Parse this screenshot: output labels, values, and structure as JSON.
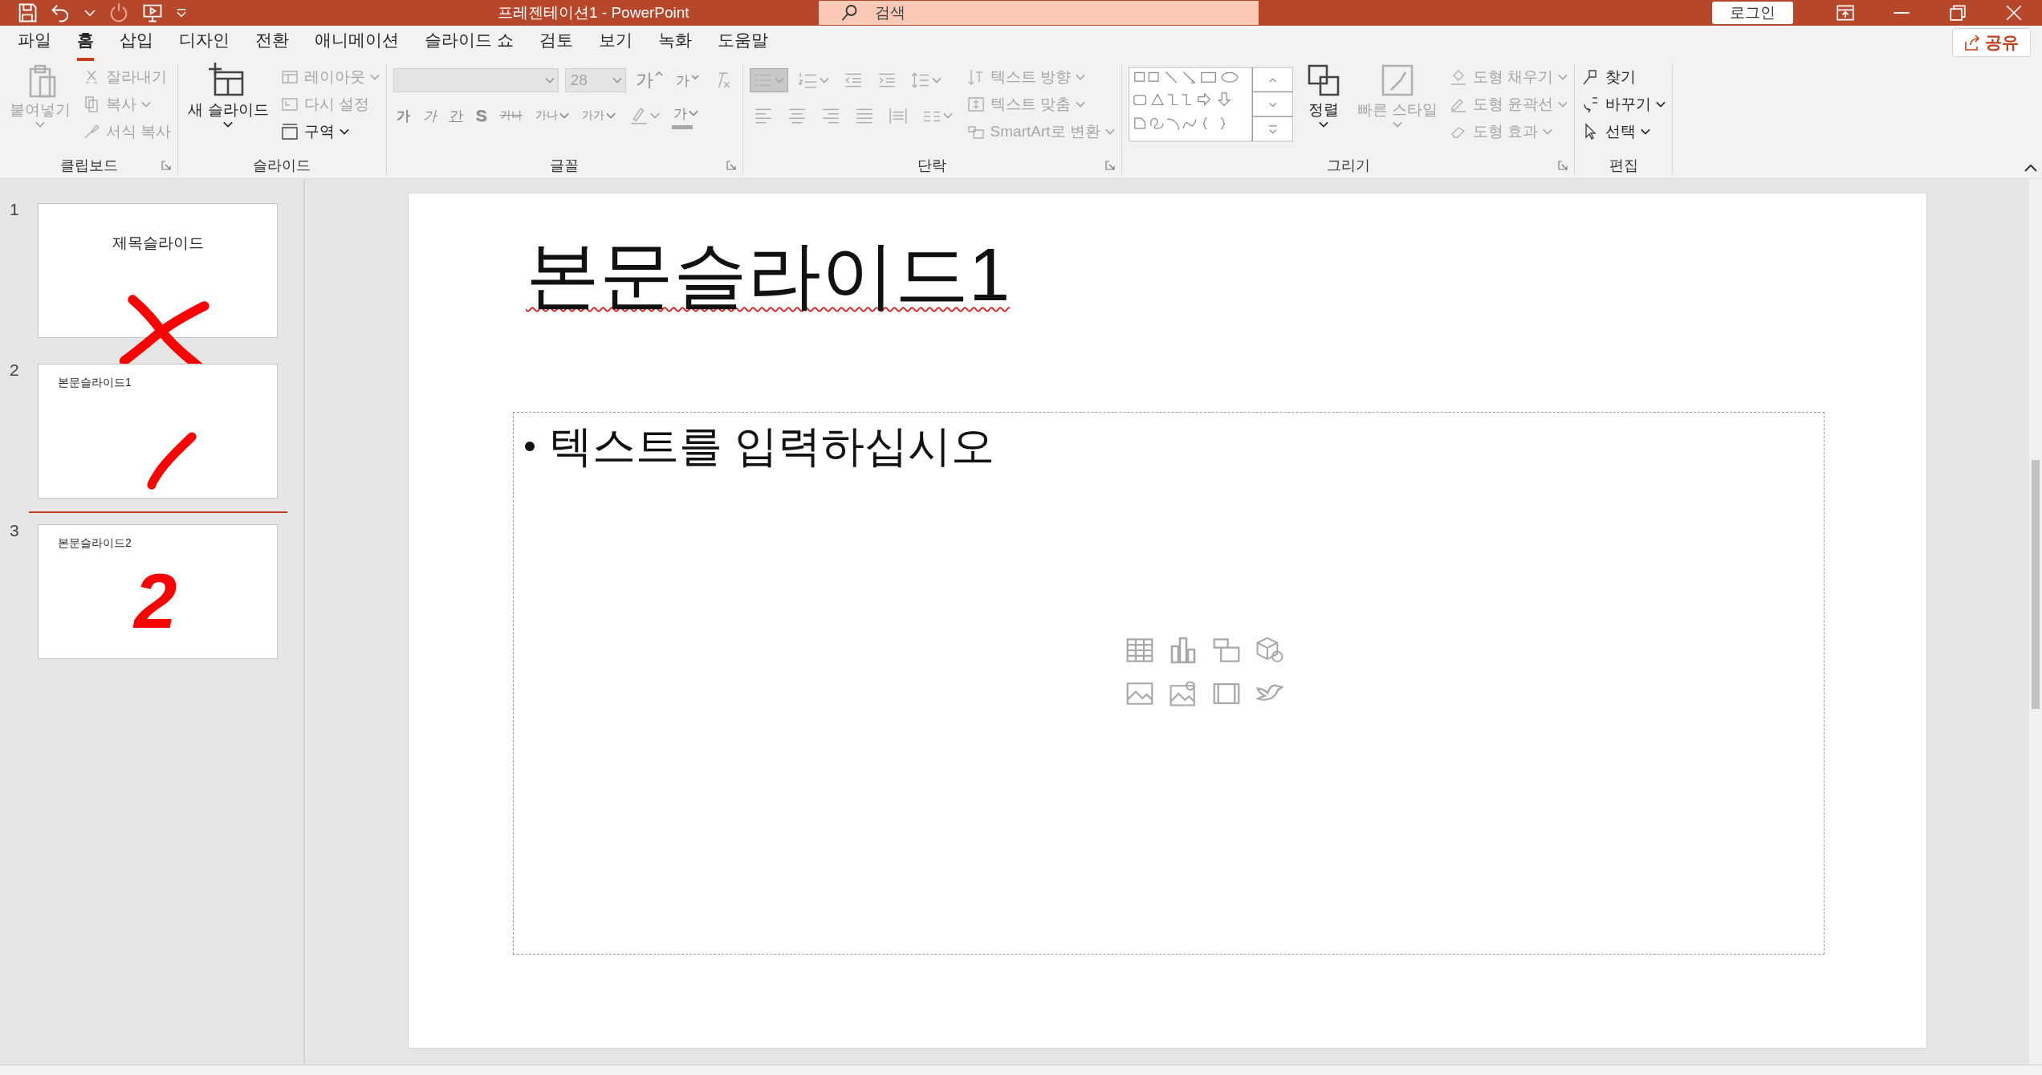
{
  "title_bar": {
    "title": "프레젠테이션1  -  PowerPoint",
    "search": {
      "placeholder": "검색"
    },
    "login_button": "로그인"
  },
  "tabs": [
    {
      "label": "파일",
      "selected": false
    },
    {
      "label": "홈",
      "selected": true
    },
    {
      "label": "삽입",
      "selected": false
    },
    {
      "label": "디자인",
      "selected": false
    },
    {
      "label": "전환",
      "selected": false
    },
    {
      "label": "애니메이션",
      "selected": false
    },
    {
      "label": "슬라이드 쇼",
      "selected": false
    },
    {
      "label": "검토",
      "selected": false
    },
    {
      "label": "보기",
      "selected": false
    },
    {
      "label": "녹화",
      "selected": false
    },
    {
      "label": "도움말",
      "selected": false
    }
  ],
  "share_button": "공유",
  "ribbon": {
    "groups": [
      {
        "label": "클립보드",
        "launcher": true,
        "items": [
          {
            "kind": "large",
            "label": "붙여넣기",
            "caret": true,
            "disabled": true
          },
          {
            "kind": "small",
            "label": "잘라내기",
            "caret": false,
            "disabled": true
          },
          {
            "kind": "small",
            "label": "복사",
            "caret": true,
            "disabled": true
          },
          {
            "kind": "small",
            "label": "서식 복사",
            "caret": false,
            "disabled": true
          }
        ]
      },
      {
        "label": "슬라이드",
        "launcher": false,
        "items": [
          {
            "kind": "large",
            "label": "새 슬라이드",
            "caret": true,
            "disabled": false
          },
          {
            "kind": "small",
            "label": "레이아웃",
            "caret": true,
            "disabled": true
          },
          {
            "kind": "small",
            "label": "다시 설정",
            "caret": false,
            "disabled": true
          },
          {
            "kind": "small",
            "label": "구역",
            "caret": true,
            "disabled": false
          }
        ]
      },
      {
        "label": "글꼴",
        "launcher": true,
        "toolbars": [
          {
            "buttons": [
              {
                "kind": "field",
                "disabled": true
              },
              {
                "kind": "field",
                "value": "28",
                "disabled": true
              },
              {
                "kind": "glyph",
                "label": "가",
                "caret": false,
                "disabled": true
              },
              {
                "kind": "glyph",
                "label": "가",
                "caret": false,
                "disabled": true
              },
              {
                "kind": "icon",
                "caret": false,
                "disabled": true,
                "selected": false
              }
            ]
          },
          {
            "buttons": [
              {
                "kind": "glyph",
                "label": "가",
                "caret": false,
                "disabled": true
              },
              {
                "kind": "glyph",
                "label": "가",
                "caret": false,
                "disabled": true
              },
              {
                "kind": "glyph",
                "label": "간",
                "caret": false,
                "disabled": true
              },
              {
                "kind": "glyph",
                "label": "S",
                "caret": false,
                "disabled": true
              },
              {
                "kind": "glyph",
                "label": "가나",
                "caret": false,
                "disabled": true
              },
              {
                "kind": "glyph",
                "label": "가나",
                "caret": true,
                "disabled": true
              },
              {
                "kind": "glyph",
                "label": "가가",
                "caret": true,
                "disabled": true
              },
              {
                "kind": "icon",
                "caret": true,
                "disabled": true,
                "selected": false
              },
              {
                "kind": "glyph",
                "label": "가",
                "caret": true,
                "disabled": true
              }
            ]
          }
        ]
      },
      {
        "label": "단락",
        "launcher": true,
        "toolbars": [
          {
            "buttons": [
              {
                "kind": "icon",
                "caret": true,
                "disabled": true,
                "selected": true
              },
              {
                "kind": "icon",
                "caret": true,
                "disabled": true,
                "selected": false
              },
              {
                "kind": "icon",
                "caret": false,
                "disabled": true,
                "selected": false
              },
              {
                "kind": "icon",
                "caret": false,
                "disabled": true,
                "selected": false
              },
              {
                "kind": "icon",
                "caret": true,
                "disabled": true,
                "selected": false
              }
            ]
          },
          {
            "buttons": [
              {
                "kind": "icon",
                "caret": false,
                "disabled": true,
                "selected": false
              },
              {
                "kind": "icon",
                "caret": false,
                "disabled": true,
                "selected": false
              },
              {
                "kind": "icon",
                "caret": false,
                "disabled": true,
                "selected": false
              },
              {
                "kind": "icon",
                "caret": false,
                "disabled": true,
                "selected": false
              },
              {
                "kind": "icon",
                "caret": false,
                "disabled": true,
                "selected": false
              },
              {
                "kind": "icon",
                "caret": true,
                "disabled": true,
                "selected": false
              }
            ]
          }
        ],
        "items": [
          {
            "kind": "small",
            "label": "텍스트 방향",
            "caret": true,
            "disabled": true
          },
          {
            "kind": "small",
            "label": "텍스트 맞춤",
            "caret": true,
            "disabled": true
          },
          {
            "kind": "small",
            "label": "SmartArt로 변환",
            "caret": true,
            "disabled": true
          }
        ]
      },
      {
        "label": "그리기",
        "launcher": true,
        "items": [
          {
            "kind": "gallery",
            "disabled": true
          },
          {
            "kind": "large",
            "label": "정렬",
            "caret": true,
            "disabled": false
          },
          {
            "kind": "large",
            "label": "빠른 스타일",
            "caret": true,
            "disabled": true
          },
          {
            "kind": "small",
            "label": "도형 채우기",
            "caret": true,
            "disabled": true
          },
          {
            "kind": "small",
            "label": "도형 윤곽선",
            "caret": true,
            "disabled": true
          },
          {
            "kind": "small",
            "label": "도형 효과",
            "caret": true,
            "disabled": true
          }
        ]
      },
      {
        "label": "편집",
        "launcher": false,
        "items": [
          {
            "kind": "small",
            "label": "찾기",
            "caret": false,
            "disabled": false
          },
          {
            "kind": "small",
            "label": "바꾸기",
            "caret": true,
            "disabled": false
          },
          {
            "kind": "small",
            "label": "선택",
            "caret": true,
            "disabled": false
          }
        ]
      }
    ]
  },
  "slides": [
    {
      "number": "1",
      "title": "제목슬라이드",
      "kind": "title",
      "drop_marker_after": false,
      "annotation": {
        "kind": "cross"
      }
    },
    {
      "number": "2",
      "title": "본문슬라이드1",
      "kind": "content",
      "drop_marker_after": true,
      "annotation": {
        "kind": "stroke"
      }
    },
    {
      "number": "3",
      "title": "본문슬라이드2",
      "kind": "content",
      "drop_marker_after": false,
      "annotation": {
        "kind": "numeral",
        "text": "2"
      }
    }
  ],
  "editor": {
    "title": "본문슬라이드1",
    "spelling_error": true,
    "bullets": [
      "텍스트를 입력하십시오"
    ]
  }
}
